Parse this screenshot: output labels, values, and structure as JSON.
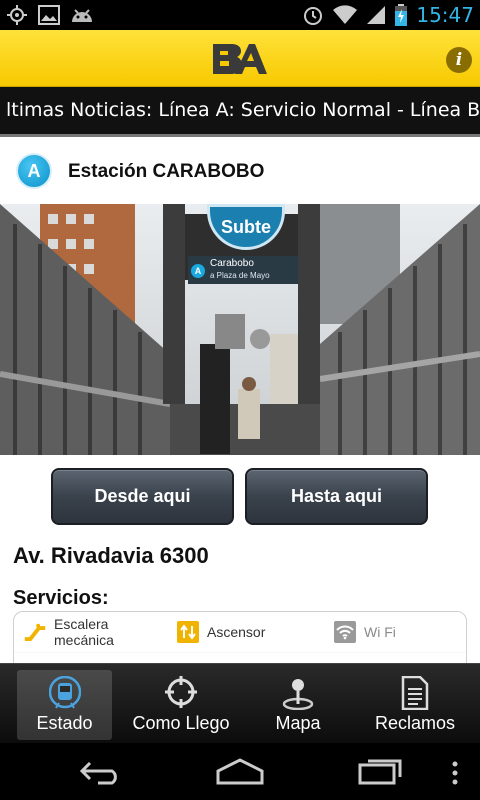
{
  "status_bar": {
    "time": "15:47",
    "left_icons": [
      "gps-icon",
      "image-icon",
      "android-icon"
    ],
    "right_icons": [
      "alarm-icon",
      "wifi-icon",
      "signal-icon",
      "battery-icon"
    ]
  },
  "header": {
    "logo_text": "BA",
    "info_label": "i",
    "accent_color": "#f7c900"
  },
  "ticker": {
    "text": "ltimas Noticias: Línea A: Servicio Normal - Línea B: Servicio Normal"
  },
  "station": {
    "line": "A",
    "name": "Estación CARABOBO",
    "photo_sign": {
      "brand": "Subte",
      "station": "Carabobo",
      "line": "A",
      "direction": "a Plaza de Mayo"
    },
    "line_color": "#19a8e0"
  },
  "actions": {
    "from_label": "Desde aqui",
    "to_label": "Hasta aqui"
  },
  "details": {
    "address": "Av. Rivadavia 6300",
    "services_title": "Servicios:",
    "services": [
      {
        "label": "Escalera mecánica",
        "icon": "escalator-icon",
        "available": true
      },
      {
        "label": "Ascensor",
        "icon": "elevator-icon",
        "available": true
      },
      {
        "label": "Wi Fi",
        "icon": "wifi-icon",
        "available": false
      }
    ]
  },
  "tabs": [
    {
      "label": "Estado",
      "icon": "train-icon",
      "active": true
    },
    {
      "label": "Como Llego",
      "icon": "crosshair-icon",
      "active": false
    },
    {
      "label": "Mapa",
      "icon": "map-pin-icon",
      "active": false
    },
    {
      "label": "Reclamos",
      "icon": "document-icon",
      "active": false
    }
  ],
  "nav": [
    "back-icon",
    "home-icon",
    "recent-apps-icon",
    "overflow-menu-icon"
  ]
}
